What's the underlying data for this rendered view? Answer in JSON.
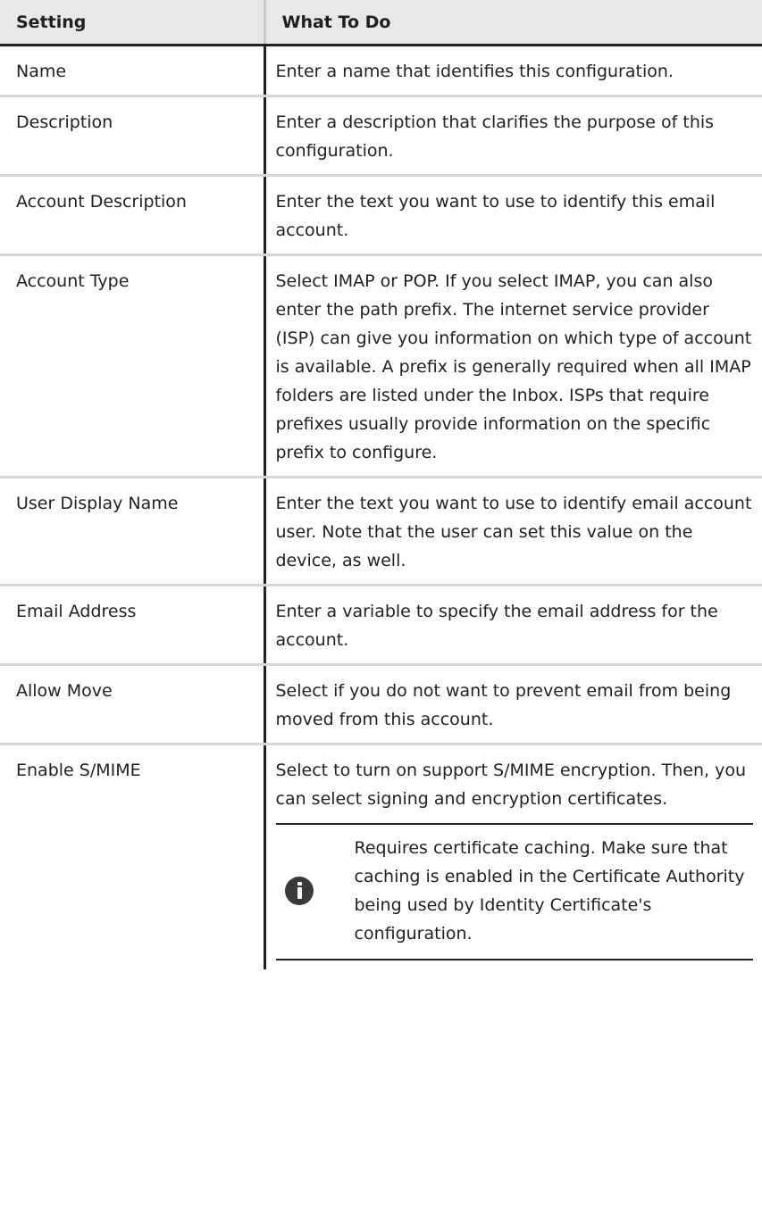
{
  "table": {
    "headers": [
      "Setting",
      "What To Do"
    ],
    "rows": [
      {
        "setting": "Name",
        "what": "Enter a name that identifies this configuration."
      },
      {
        "setting": "Description",
        "what": "Enter a description that clarifies the purpose of this configuration."
      },
      {
        "setting": "Account Description",
        "what": "Enter the text you want to use to identify this email account."
      },
      {
        "setting": "Account Type",
        "what": "Select IMAP or POP. If you select IMAP, you can also enter the path prefix. The internet service provider (ISP) can give you information on which type of account is available. A prefix is generally required when all IMAP folders are listed under the Inbox. ISPs that require prefixes usually provide information on the specific prefix to configure."
      },
      {
        "setting": "User Display Name",
        "what": "Enter the text you want to use to identify email account user. Note that the user can set this value on the device, as well."
      },
      {
        "setting": "Email Address",
        "what": "Enter a variable to specify the email address for the account."
      },
      {
        "setting": "Allow Move",
        "what": "Select if you do not want to prevent email from being moved from this account."
      },
      {
        "setting": "Enable S/MIME",
        "what": "Select to turn on support S/MIME encryption. Then, you can select signing and encryption certificates.",
        "note": "Requires certificate caching. Make sure that caching is enabled in the Certificate Authority being used by Identity Certificate's configuration.",
        "note_icon": "info-icon"
      }
    ]
  }
}
